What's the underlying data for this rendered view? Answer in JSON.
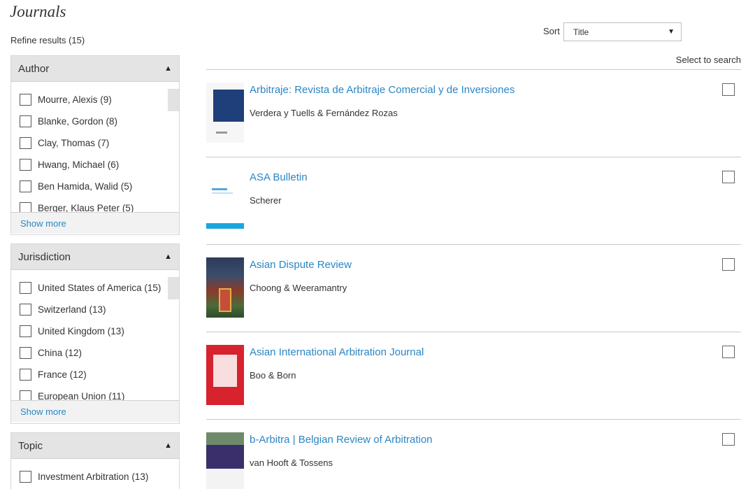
{
  "page_title": "Journals",
  "refine_label": "Refine results (15)",
  "facets": [
    {
      "title": "Author",
      "items": [
        "Mourre, Alexis (9)",
        "Blanke, Gordon (8)",
        "Clay, Thomas (7)",
        "Hwang, Michael (6)",
        "Ben Hamida, Walid (5)",
        "Berger, Klaus Peter (5)"
      ],
      "show_more": "Show more"
    },
    {
      "title": "Jurisdiction",
      "items": [
        "United States of America (15)",
        "Switzerland (13)",
        "United Kingdom (13)",
        "China (12)",
        "France (12)",
        "European Union (11)"
      ],
      "show_more": "Show more"
    },
    {
      "title": "Topic",
      "items": [
        "Investment Arbitration (13)"
      ]
    }
  ],
  "sort": {
    "label": "Sort",
    "value": "Title"
  },
  "select_to_search": "Select to search",
  "results": [
    {
      "title": "Arbitraje: Revista de Arbitraje Comercial y de Inversiones",
      "authors": "Verdera y Tuells & Fernández Rozas"
    },
    {
      "title": "ASA Bulletin",
      "authors": "Scherer"
    },
    {
      "title": "Asian Dispute Review",
      "authors": "Choong & Weeramantry"
    },
    {
      "title": "Asian International Arbitration Journal",
      "authors": "Boo & Born"
    },
    {
      "title": "b-Arbitra | Belgian Review of Arbitration",
      "authors": "van Hooft & Tossens"
    }
  ]
}
